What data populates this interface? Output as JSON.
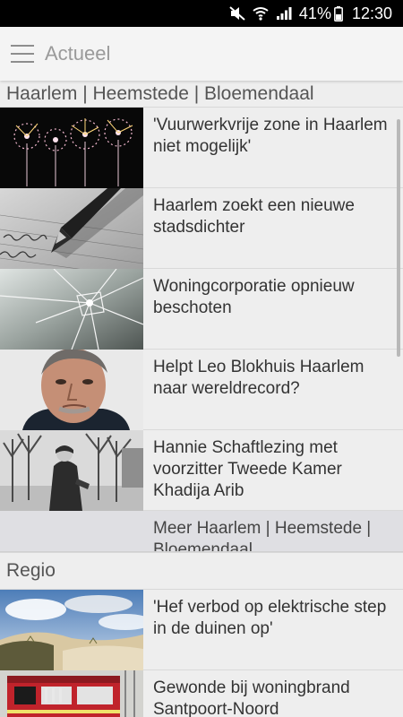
{
  "status": {
    "battery": "41%",
    "time": "12:30"
  },
  "appbar": {
    "title": "Actueel"
  },
  "sections": {
    "local": {
      "header": "Haarlem | Heemstede | Bloemendaal",
      "items": [
        {
          "title": "'Vuurwerkvrije zone in Haarlem niet mogelijk'"
        },
        {
          "title": "Haarlem zoekt een nieuwe stadsdichter"
        },
        {
          "title": "Woningcorporatie opnieuw beschoten"
        },
        {
          "title": "Helpt Leo Blokhuis Haarlem naar wereldrecord?"
        },
        {
          "title": "Hannie Schaftlezing met voorzitter Tweede Kamer Khadija Arib"
        }
      ],
      "more": "Meer Haarlem | Heemstede | Bloemendaal"
    },
    "regio": {
      "header": "Regio",
      "items": [
        {
          "title": "'Hef verbod op elektrische step in de duinen op'"
        },
        {
          "title": "Gewonde bij woningbrand Santpoort-Noord"
        }
      ]
    }
  }
}
